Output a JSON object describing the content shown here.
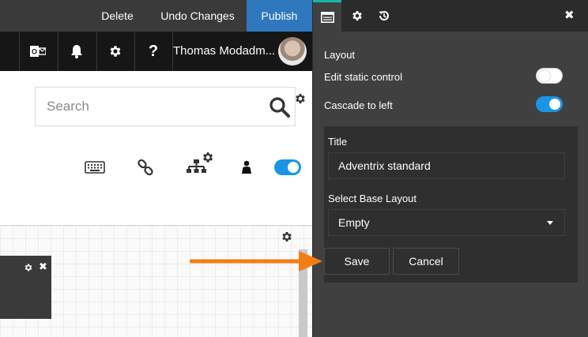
{
  "topbar": {
    "delete_label": "Delete",
    "undo_label": "Undo Changes",
    "publish_label": "Publish"
  },
  "header": {
    "icons": [
      "outlook-icon",
      "bell-icon",
      "gear-icon",
      "help-icon"
    ],
    "help_glyph": "?",
    "user_name": "Thomas Modadm..."
  },
  "search": {
    "placeholder": "Search"
  },
  "toolbar_icons": [
    "keyboard-icon",
    "link-icon",
    "sitemap-settings-icon",
    "person-icon"
  ],
  "panel": {
    "tabs": [
      "layout-tab",
      "settings-tab",
      "history-tab"
    ],
    "close_glyph": "✖",
    "section_label": "Layout",
    "edit_static_label": "Edit static control",
    "edit_static_on": false,
    "cascade_label": "Cascade to left",
    "cascade_on": true,
    "title_label": "Title",
    "title_value": "Adventrix standard",
    "base_layout_label": "Select Base Layout",
    "base_layout_value": "Empty",
    "save_label": "Save",
    "cancel_label": "Cancel"
  },
  "colors": {
    "publish": "#2f78bd",
    "toggle_on": "#1a95e6",
    "active_tab_accent": "#19b6a6",
    "arrow": "#f57c14"
  }
}
